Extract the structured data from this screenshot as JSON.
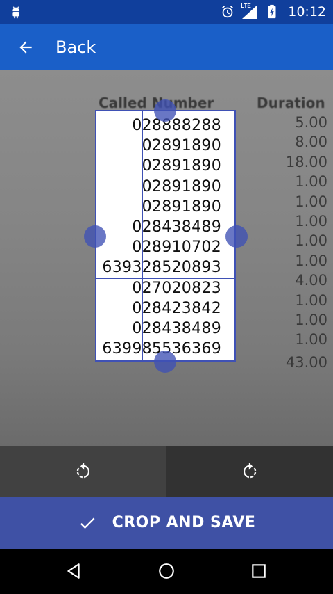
{
  "status_bar": {
    "time": "10:12",
    "network": "LTE",
    "icons": [
      "android-debug-icon",
      "alarm-icon",
      "signal-icon",
      "battery-charging-icon"
    ]
  },
  "app_bar": {
    "back_label": "Back"
  },
  "photo": {
    "header_called": "Called Number",
    "header_duration": "Duration",
    "durations": [
      "5.00",
      "8.00",
      "18.00",
      "1.00",
      "1.00",
      "1.00",
      "1.00",
      "1.00",
      "4.00",
      "1.00",
      "1.00",
      "1.00",
      "43.00"
    ]
  },
  "crop": {
    "numbers": [
      "028888288",
      "02891890",
      "02891890",
      "02891890",
      "02891890",
      "028438489",
      "028910702",
      "639328520893",
      "027020823",
      "028423842",
      "028438489",
      "639985536369"
    ]
  },
  "actions": {
    "rotate_left_icon": "rotate-left-icon",
    "rotate_right_icon": "rotate-right-icon",
    "save_label": "CROP AND SAVE"
  },
  "colors": {
    "status_bar": "#103f9c",
    "app_bar": "#1a5fc8",
    "accent": "#3f51b5",
    "save_bar": "#3f51a5"
  }
}
